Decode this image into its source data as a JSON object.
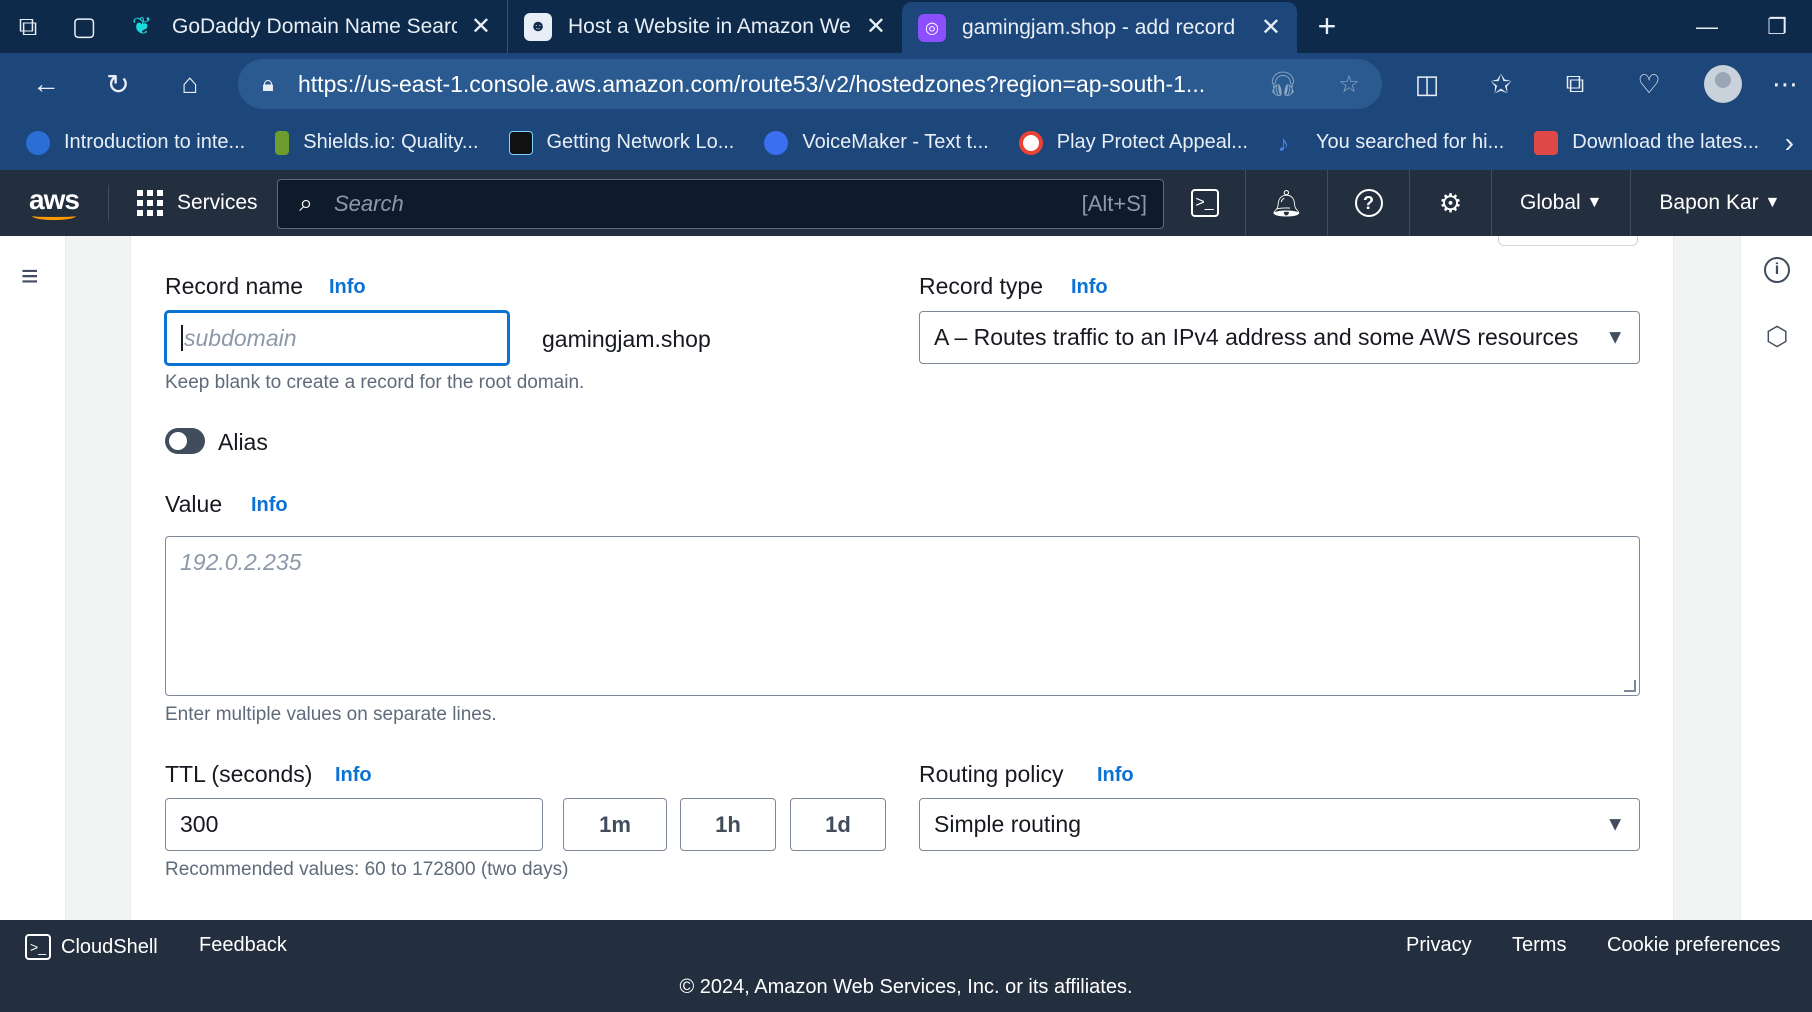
{
  "browser": {
    "tabs": [
      {
        "title": "GoDaddy Domain Name Search",
        "active": false
      },
      {
        "title": "Host a Website in Amazon Web S",
        "active": false
      },
      {
        "title": "gamingjam.shop - add record",
        "active": true
      }
    ],
    "url": "https://us-east-1.console.aws.amazon.com/route53/v2/hostedzones?region=ap-south-1...",
    "bookmarks": [
      {
        "label": "Introduction to inte...",
        "color": "#2b6fd6"
      },
      {
        "label": "Shields.io: Quality...",
        "color": "#6b9e2f"
      },
      {
        "label": "Getting Network Lo...",
        "color": "#111111"
      },
      {
        "label": "VoiceMaker - Text t...",
        "color": "#3b6ff0"
      },
      {
        "label": "Play Protect Appeal...",
        "color": "#ffffff"
      },
      {
        "label": "You searched for hi...",
        "color": "#4b8ff0"
      },
      {
        "label": "Download the lates...",
        "color": "#e04848"
      }
    ]
  },
  "aws_header": {
    "logo": "aws",
    "services_label": "Services",
    "search_placeholder": "Search",
    "search_shortcut": "[Alt+S]",
    "region_label": "Global",
    "account_label": "Bapon Kar"
  },
  "form": {
    "record_name_label": "Record name",
    "record_name_info": "Info",
    "record_name_placeholder": "subdomain",
    "domain_suffix": "gamingjam.shop",
    "record_name_hint": "Keep blank to create a record for the root domain.",
    "record_type_label": "Record type",
    "record_type_info": "Info",
    "record_type_value": "A – Routes traffic to an IPv4 address and some AWS resources",
    "alias_label": "Alias",
    "value_label": "Value",
    "value_info": "Info",
    "value_placeholder": "192.0.2.235",
    "value_hint": "Enter multiple values on separate lines.",
    "ttl_label": "TTL (seconds)",
    "ttl_info": "Info",
    "ttl_value": "300",
    "ttl_buttons": [
      "1m",
      "1h",
      "1d"
    ],
    "ttl_hint": "Recommended values: 60 to 172800 (two days)",
    "routing_label": "Routing policy",
    "routing_info": "Info",
    "routing_value": "Simple routing"
  },
  "footer": {
    "cloudshell": "CloudShell",
    "feedback": "Feedback",
    "privacy": "Privacy",
    "terms": "Terms",
    "cookie": "Cookie preferences",
    "copyright": "© 2024, Amazon Web Services, Inc. or its affiliates."
  }
}
